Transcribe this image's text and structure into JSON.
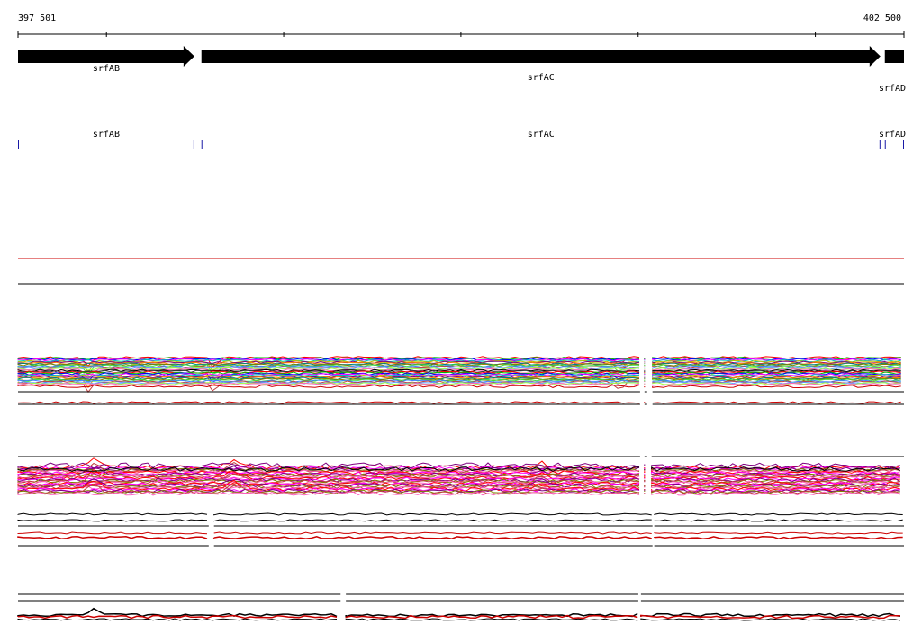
{
  "ruler": {
    "start_label": "397 501",
    "end_label": "402 500",
    "start": 397501,
    "end": 402500
  },
  "genes": [
    {
      "name": "srfAB",
      "start": 397501,
      "end": 398496,
      "strand": "+"
    },
    {
      "name": "srfAC",
      "start": 398536,
      "end": 402367,
      "strand": "+"
    },
    {
      "name": "srfAD",
      "start": 402392,
      "end": 402500,
      "strand": "+"
    }
  ],
  "cds": [
    {
      "name": "srfAB",
      "start": 397501,
      "end": 398496
    },
    {
      "name": "srfAC",
      "start": 398536,
      "end": 402367
    },
    {
      "name": "srfAD",
      "start": 402392,
      "end": 402500
    }
  ],
  "colors": {
    "arrow": "#000000",
    "cds_outline": "#1a1aa6",
    "red_line": "#cc0000",
    "black_line": "#000000",
    "palette": [
      "#ff0000",
      "#00c000",
      "#0000ff",
      "#ff00ff",
      "#00c0c0",
      "#c0c000",
      "#800080",
      "#ff8000",
      "#008080",
      "#808000",
      "#40e040",
      "#4080ff",
      "#c04040",
      "#60a0ff",
      "#a0ff40",
      "#ff60c0",
      "#000000",
      "#404040"
    ]
  },
  "track_segments": {
    "group1": [
      [
        397501,
        401011
      ],
      [
        401036,
        401051
      ],
      [
        401081,
        402500
      ]
    ],
    "group2": [
      [
        397501,
        401011
      ],
      [
        401036,
        401051
      ],
      [
        401076,
        402500
      ]
    ],
    "group3": [
      [
        397501,
        398577
      ],
      [
        398607,
        401081
      ],
      [
        401091,
        402500
      ]
    ],
    "group4": [
      [
        397501,
        399321
      ],
      [
        399351,
        401001
      ],
      [
        401016,
        402500
      ]
    ]
  }
}
